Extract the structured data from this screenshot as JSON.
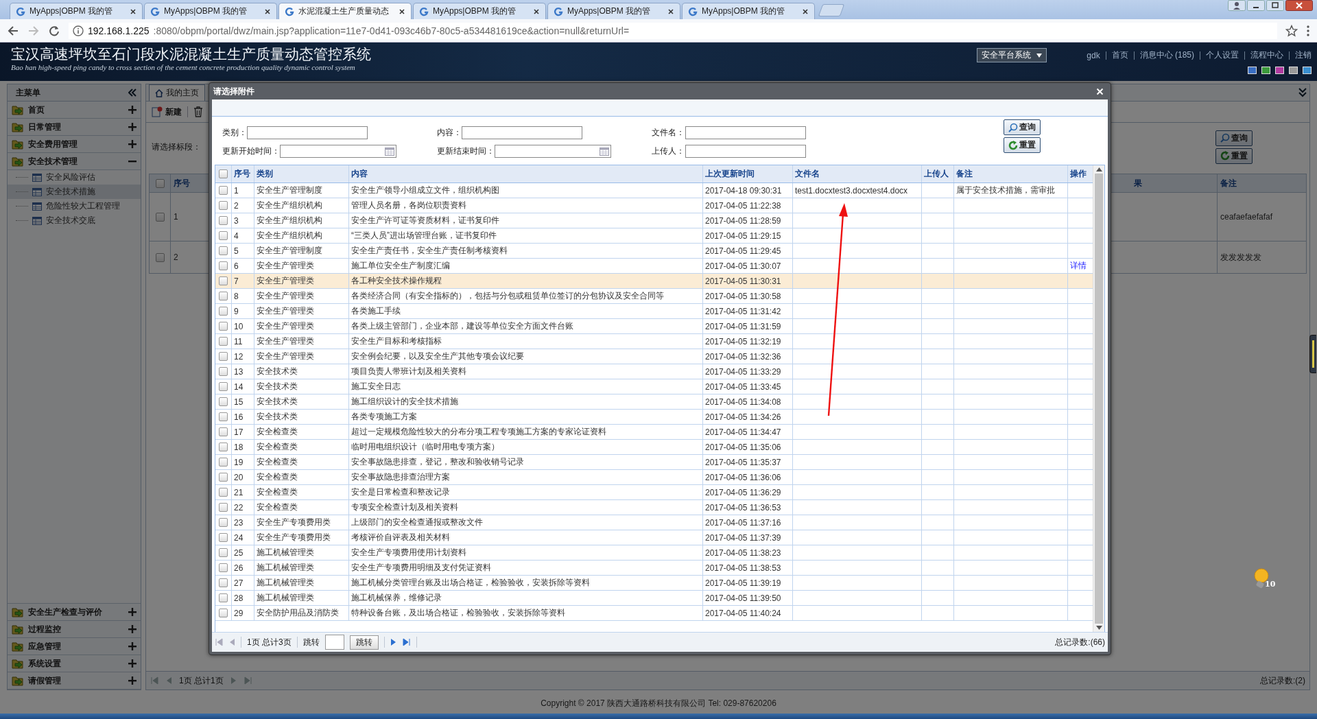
{
  "browser": {
    "tabs": [
      {
        "title": "MyApps|OBPM 我的管",
        "selected": false
      },
      {
        "title": "MyApps|OBPM 我的管",
        "selected": false
      },
      {
        "title": "水泥混凝土生产质量动态",
        "selected": true
      },
      {
        "title": "MyApps|OBPM 我的管",
        "selected": false
      },
      {
        "title": "MyApps|OBPM 我的管",
        "selected": false
      },
      {
        "title": "MyApps|OBPM 我的管",
        "selected": false
      }
    ],
    "url_host": "192.168.1.225",
    "url_rest": ":8080/obpm/portal/dwz/main.jsp?application=11e7-0d41-093c46b7-80c5-a534481619ce&action=null&returnUrl="
  },
  "header": {
    "title": "宝汉高速坪坎至石门段水泥混凝土生产质量动态管控系统",
    "subtitle": "Bao han high-speed ping candy to cross section of the cement concrete production quality dynamic control system",
    "system_select": "安全平台系统",
    "links": [
      "gdk",
      "首页",
      "消息中心 (185)",
      "个人设置",
      "流程中心",
      "注销"
    ]
  },
  "sidebar": {
    "title": "主菜单",
    "items": [
      {
        "label": "首页",
        "expanded": false
      },
      {
        "label": "日常管理",
        "expanded": false
      },
      {
        "label": "安全费用管理",
        "expanded": false
      },
      {
        "label": "安全技术管理",
        "expanded": true,
        "children": [
          {
            "label": "安全风险评估",
            "selected": false
          },
          {
            "label": "安全技术措施",
            "selected": true
          },
          {
            "label": "危险性较大工程管理",
            "selected": false
          },
          {
            "label": "安全技术交底",
            "selected": false
          }
        ]
      }
    ],
    "bottom_items": [
      {
        "label": "安全生产检查与评价",
        "expanded": false
      },
      {
        "label": "过程监控",
        "expanded": false
      },
      {
        "label": "应急管理",
        "expanded": false
      },
      {
        "label": "系统设置",
        "expanded": false
      },
      {
        "label": "请假管理",
        "expanded": false
      }
    ]
  },
  "main": {
    "tabs": [
      {
        "label": "我的主页",
        "selected": true
      }
    ],
    "new_button": "新建",
    "filter_label": "请选择标段：",
    "buttons": [
      {
        "label": "查询",
        "kind": "search"
      },
      {
        "label": "重置",
        "kind": "reset"
      }
    ],
    "table": {
      "header_checked": false,
      "columns": [
        "序号",
        "果",
        "备注"
      ],
      "rows": [
        {
          "checked": false,
          "no": "1",
          "remark": "ceafaefaefafaf"
        },
        {
          "checked": false,
          "no": "2",
          "remark": "发发发发发"
        }
      ]
    },
    "pager": {
      "page_info": "1页 总计1页",
      "total": "总记录数:(2)"
    }
  },
  "dialog": {
    "title": "请选择附件",
    "filters": [
      {
        "label": "类别：",
        "kind": "text"
      },
      {
        "label": "内容：",
        "kind": "text"
      },
      {
        "label": "文件名：",
        "kind": "text"
      },
      {
        "label": "更新开始时间：",
        "kind": "date"
      },
      {
        "label": "更新结束时间：",
        "kind": "date"
      },
      {
        "label": "上传人：",
        "kind": "text"
      }
    ],
    "buttons": [
      {
        "label": "查询",
        "kind": "search"
      },
      {
        "label": "重置",
        "kind": "reset"
      }
    ],
    "table": {
      "header_checked": false,
      "columns": [
        "序号",
        "类别",
        "内容",
        "上次更新时间",
        "文件名",
        "上传人",
        "备注",
        "操作"
      ],
      "rows": [
        {
          "checked": false,
          "selected": false,
          "no": "1",
          "category": "安全生产管理制度",
          "content": "安全生产领导小组成立文件，组织机构图",
          "updated": "2017-04-18 09:30:31",
          "file_name": "test1.docxtest3.docxtest4.docx",
          "remark": "属于安全技术措施，需审批"
        },
        {
          "checked": false,
          "selected": false,
          "no": "2",
          "category": "安全生产组织机构",
          "content": "管理人员名册，各岗位职责资料",
          "updated": "2017-04-05 11:22:38"
        },
        {
          "checked": false,
          "selected": false,
          "no": "3",
          "category": "安全生产组织机构",
          "content": "安全生产许可证等资质材料，证书复印件",
          "updated": "2017-04-05 11:28:59"
        },
        {
          "checked": false,
          "selected": false,
          "no": "4",
          "category": "安全生产组织机构",
          "content": "“三类人员”进出场管理台账，证书复印件",
          "updated": "2017-04-05 11:29:15"
        },
        {
          "checked": false,
          "selected": false,
          "no": "5",
          "category": "安全生产管理制度",
          "content": "安全生产责任书，安全生产责任制考核资料",
          "updated": "2017-04-05 11:29:45"
        },
        {
          "checked": false,
          "selected": false,
          "no": "6",
          "category": "安全生产管理类",
          "content": "施工单位安全生产制度汇编",
          "updated": "2017-04-05 11:30:07",
          "action": "详情"
        },
        {
          "checked": false,
          "selected": true,
          "no": "7",
          "category": "安全生产管理类",
          "content": "各工种安全技术操作规程",
          "updated": "2017-04-05 11:30:31"
        },
        {
          "checked": false,
          "selected": false,
          "no": "8",
          "category": "安全生产管理类",
          "content": "各类经济合同（有安全指标的），包括与分包或租赁单位签订的分包协议及安全合同等",
          "updated": "2017-04-05 11:30:58"
        },
        {
          "checked": false,
          "selected": false,
          "no": "9",
          "category": "安全生产管理类",
          "content": "各类施工手续",
          "updated": "2017-04-05 11:31:42"
        },
        {
          "checked": false,
          "selected": false,
          "no": "10",
          "category": "安全生产管理类",
          "content": "各类上级主管部门，企业本部，建设等单位安全方面文件台账",
          "updated": "2017-04-05 11:31:59"
        },
        {
          "checked": false,
          "selected": false,
          "no": "11",
          "category": "安全生产管理类",
          "content": "安全生产目标和考核指标",
          "updated": "2017-04-05 11:32:19"
        },
        {
          "checked": false,
          "selected": false,
          "no": "12",
          "category": "安全生产管理类",
          "content": "安全例会纪要，以及安全生产其他专项会议纪要",
          "updated": "2017-04-05 11:32:36"
        },
        {
          "checked": false,
          "selected": false,
          "no": "13",
          "category": "安全技术类",
          "content": "项目负责人带班计划及相关资料",
          "updated": "2017-04-05 11:33:29"
        },
        {
          "checked": false,
          "selected": false,
          "no": "14",
          "category": "安全技术类",
          "content": "施工安全日志",
          "updated": "2017-04-05 11:33:45"
        },
        {
          "checked": false,
          "selected": false,
          "no": "15",
          "category": "安全技术类",
          "content": "施工组织设计的安全技术措施",
          "updated": "2017-04-05 11:34:08"
        },
        {
          "checked": false,
          "selected": false,
          "no": "16",
          "category": "安全技术类",
          "content": "各类专项施工方案",
          "updated": "2017-04-05 11:34:26"
        },
        {
          "checked": false,
          "selected": false,
          "no": "17",
          "category": "安全检查类",
          "content": "超过一定规模危险性较大的分布分项工程专项施工方案的专家论证资料",
          "updated": "2017-04-05 11:34:47"
        },
        {
          "checked": false,
          "selected": false,
          "no": "18",
          "category": "安全检查类",
          "content": "临时用电组织设计（临时用电专项方案）",
          "updated": "2017-04-05 11:35:06"
        },
        {
          "checked": false,
          "selected": false,
          "no": "19",
          "category": "安全检查类",
          "content": "安全事故隐患排查，登记，整改和验收销号记录",
          "updated": "2017-04-05 11:35:37"
        },
        {
          "checked": false,
          "selected": false,
          "no": "20",
          "category": "安全检查类",
          "content": "安全事故隐患排查治理方案",
          "updated": "2017-04-05 11:36:06"
        },
        {
          "checked": false,
          "selected": false,
          "no": "21",
          "category": "安全检查类",
          "content": "安全是日常检查和整改记录",
          "updated": "2017-04-05 11:36:29"
        },
        {
          "checked": false,
          "selected": false,
          "no": "22",
          "category": "安全检查类",
          "content": "专项安全检查计划及相关资料",
          "updated": "2017-04-05 11:36:53"
        },
        {
          "checked": false,
          "selected": false,
          "no": "23",
          "category": "安全生产专项费用类",
          "content": "上级部门的安全检查通报或整改文件",
          "updated": "2017-04-05 11:37:16"
        },
        {
          "checked": false,
          "selected": false,
          "no": "24",
          "category": "安全生产专项费用类",
          "content": "考核评价自评表及相关材料",
          "updated": "2017-04-05 11:37:39"
        },
        {
          "checked": false,
          "selected": false,
          "no": "25",
          "category": "施工机械管理类",
          "content": "安全生产专项费用使用计划资料",
          "updated": "2017-04-05 11:38:23"
        },
        {
          "checked": false,
          "selected": false,
          "no": "26",
          "category": "施工机械管理类",
          "content": "安全生产专项费用明细及支付凭证资料",
          "updated": "2017-04-05 11:38:53"
        },
        {
          "checked": false,
          "selected": false,
          "no": "27",
          "category": "施工机械管理类",
          "content": "施工机械分类管理台账及出场合格证，检验验收，安装拆除等资料",
          "updated": "2017-04-05 11:39:19"
        },
        {
          "checked": false,
          "selected": false,
          "no": "28",
          "category": "施工机械管理类",
          "content": "施工机械保养，维修记录",
          "updated": "2017-04-05 11:39:50"
        },
        {
          "checked": false,
          "selected": false,
          "no": "29",
          "category": "安全防护用品及消防类",
          "content": "特种设备台账，及出场合格证，检验验收，安装拆除等资料",
          "updated": "2017-04-05 11:40:24"
        }
      ]
    },
    "pager": {
      "page_info": "1页 总计3页",
      "jump_label": "跳转",
      "jump_button": "跳转",
      "total": "总记录数:(66)"
    }
  },
  "footer": "Copyright © 2017 陕西大通路桥科技有限公司 Tel: 029-87620206",
  "notification": {
    "count": "10"
  }
}
